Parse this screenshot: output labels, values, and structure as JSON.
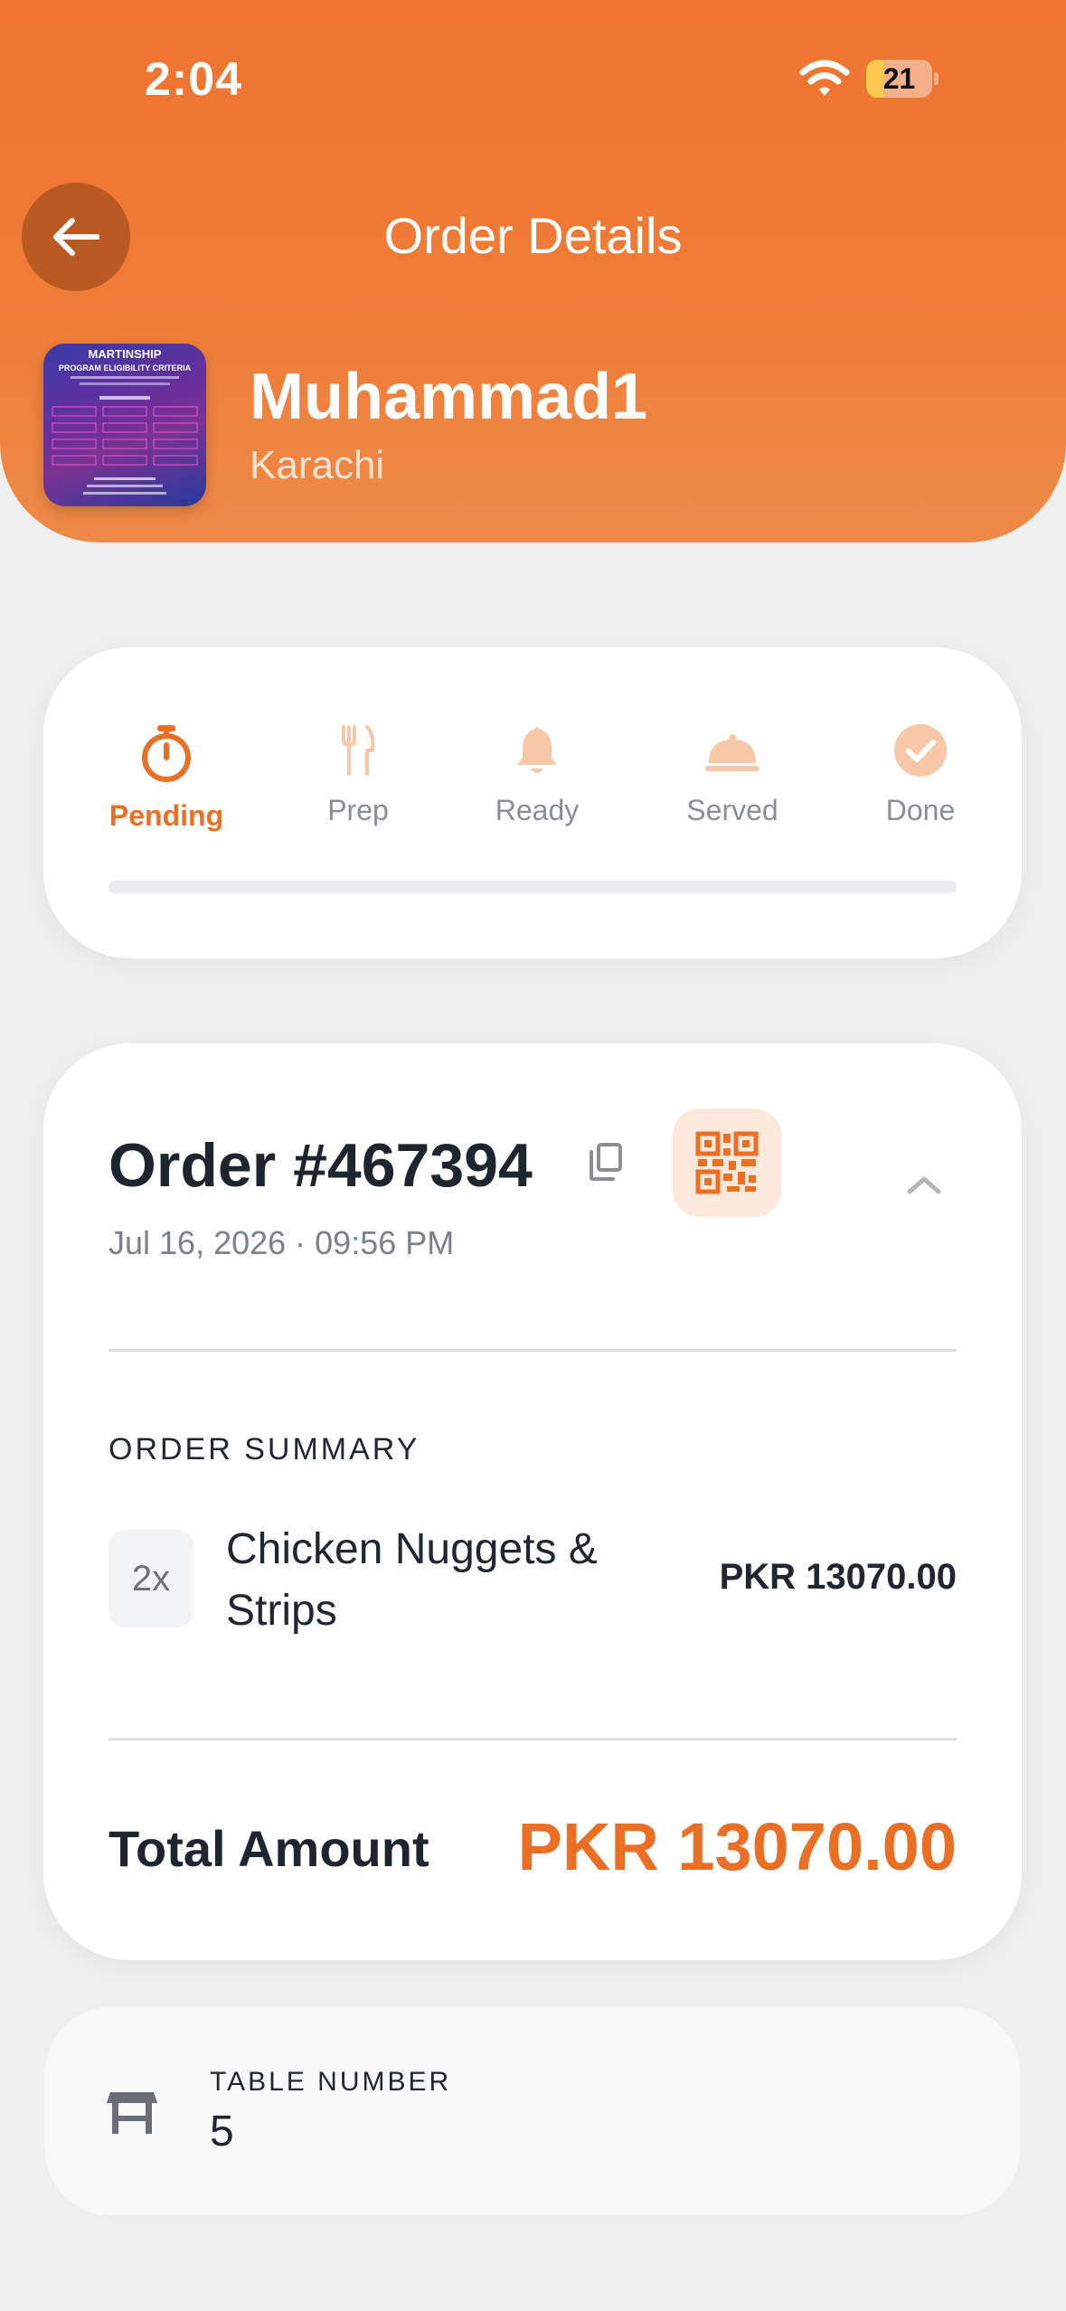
{
  "status_bar": {
    "time": "2:04",
    "battery": "21"
  },
  "header": {
    "title": "Order Details",
    "shop_name": "Muhammad1",
    "shop_city": "Karachi",
    "logo_text": {
      "line1": "MARTINSHIP",
      "line2": "PROGRAM ELIGIBILITY CRITERIA"
    }
  },
  "status_steps": [
    {
      "label": "Pending",
      "icon": "timer-icon",
      "active": true
    },
    {
      "label": "Prep",
      "icon": "fork-knife-icon",
      "active": false
    },
    {
      "label": "Ready",
      "icon": "bell-icon",
      "active": false
    },
    {
      "label": "Served",
      "icon": "cloche-icon",
      "active": false
    },
    {
      "label": "Done",
      "icon": "check-circle-icon",
      "active": false
    }
  ],
  "progress": 0,
  "order": {
    "number": "Order #467394",
    "date": "Jul 16, 2026 · 09:56 PM",
    "summary_heading": "ORDER SUMMARY",
    "items": [
      {
        "qty": "2x",
        "name": "Chicken Nuggets & Strips",
        "price": "PKR 13070.00"
      }
    ],
    "total_label": "Total Amount",
    "total_value": "PKR 13070.00"
  },
  "table": {
    "label": "TABLE NUMBER",
    "value": "5"
  },
  "colors": {
    "accent": "#ea6f25",
    "accent_light": "#f7c7a6",
    "header": "#ee7430"
  }
}
